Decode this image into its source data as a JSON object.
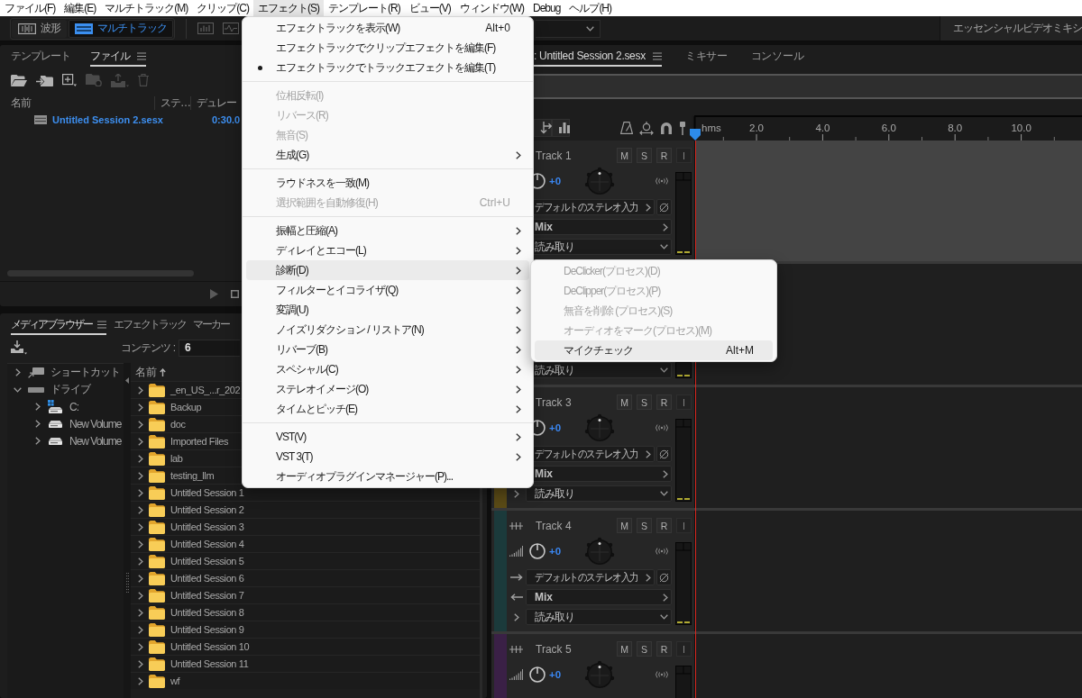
{
  "menu_bar": {
    "items": [
      {
        "label": "ファイル(F)",
        "selected": false
      },
      {
        "label": "編集(E)",
        "selected": false
      },
      {
        "label": "マルチトラック(M)",
        "selected": false
      },
      {
        "label": "クリップ(C)",
        "selected": false
      },
      {
        "label": "エフェクト(S)",
        "selected": true
      },
      {
        "label": "テンプレート(R)",
        "selected": false
      },
      {
        "label": "ビュー(V)",
        "selected": false
      },
      {
        "label": "ウィンドウ(W)",
        "selected": false
      },
      {
        "label": "Debug",
        "selected": false
      },
      {
        "label": "ヘルプ(H)",
        "selected": false
      }
    ]
  },
  "toolbar": {
    "views": [
      {
        "kind": "waveform",
        "label": "波形",
        "selected": false
      },
      {
        "kind": "multitrack",
        "label": "マルチトラック",
        "selected": true
      }
    ],
    "workspace": "エッセンシャルビデオミキシ"
  },
  "files_panel": {
    "tabs": [
      {
        "label": "テンプレート",
        "selected": false
      },
      {
        "label": "ファイル",
        "selected": true
      }
    ],
    "columns": [
      "名前",
      "ステ…",
      "デュレー"
    ],
    "rows": [
      {
        "name": "Untitled Session 2.sesx",
        "duration": "0:30.0"
      }
    ]
  },
  "media_browser": {
    "tabs": [
      {
        "label": "メディアブラウザー",
        "selected": true
      },
      {
        "label": "エフェクトラック",
        "selected": false
      },
      {
        "label": "マーカー",
        "selected": false
      }
    ],
    "contents_label": "コンテンツ :",
    "contents_value": "6",
    "tree": [
      {
        "kind": "shortcut",
        "label": "ショートカット",
        "expanded": false
      },
      {
        "kind": "drives",
        "label": "ドライブ",
        "expanded": true,
        "children": [
          {
            "kind": "system",
            "label": "C:",
            "expanded": false
          },
          {
            "kind": "volume",
            "label": "New Volume",
            "expanded": false
          },
          {
            "kind": "volume",
            "label": "New Volume",
            "expanded": false
          }
        ]
      }
    ],
    "list_column": "名前",
    "files": [
      {
        "name": "_en_US_...r_202",
        "expanded": false
      },
      {
        "name": "Backup",
        "expanded": false
      },
      {
        "name": "doc",
        "expanded": false
      },
      {
        "name": "Imported Files",
        "expanded": false
      },
      {
        "name": "lab",
        "expanded": false
      },
      {
        "name": "testing_llm",
        "expanded": false
      },
      {
        "name": "Untitled Session 1",
        "expanded": false
      },
      {
        "name": "Untitled Session 2",
        "expanded": false
      },
      {
        "name": "Untitled Session 3",
        "expanded": false
      },
      {
        "name": "Untitled Session 4",
        "expanded": false
      },
      {
        "name": "Untitled Session 5",
        "expanded": false
      },
      {
        "name": "Untitled Session 6",
        "expanded": false
      },
      {
        "name": "Untitled Session 7",
        "expanded": false
      },
      {
        "name": "Untitled Session 8",
        "expanded": false
      },
      {
        "name": "Untitled Session 9",
        "expanded": false
      },
      {
        "name": "Untitled Session 10",
        "expanded": false
      },
      {
        "name": "Untitled Session 11",
        "expanded": false
      },
      {
        "name": "wf",
        "expanded": false
      }
    ]
  },
  "editor": {
    "tabs": [
      {
        "label": ": Untitled Session 2.sesx",
        "selected": true
      },
      {
        "label": "ミキサー",
        "selected": false
      },
      {
        "label": "コンソール",
        "selected": false
      }
    ],
    "ruler": [
      "hms",
      "2.0",
      "4.0",
      "6.0",
      "8.0",
      "10.0"
    ],
    "tracks": [
      {
        "kind": "covered",
        "selected": true,
        "name": "Track 1",
        "buttons": [
          {
            "label": "M",
            "disabled": false
          },
          {
            "label": "S",
            "disabled": false
          },
          {
            "label": "R",
            "disabled": false
          },
          {
            "label": "I",
            "disabled": true
          }
        ],
        "volume": "+0",
        "input": "デフォルトのステレオ入力",
        "output": "Mix",
        "automation": "読み取り"
      },
      {
        "kind": "hidden",
        "selected": false,
        "automation": "読み取り"
      },
      {
        "kind": "partial",
        "selected": false,
        "color": "#5a4a16",
        "name": "Track 3",
        "buttons": [
          {
            "label": "M",
            "disabled": false
          },
          {
            "label": "S",
            "disabled": false
          },
          {
            "label": "R",
            "disabled": false
          },
          {
            "label": "I",
            "disabled": true
          }
        ],
        "volume": "+0",
        "input": "デフォルトのステレオ入力",
        "output": "Mix",
        "automation": "読み取り"
      },
      {
        "kind": "full",
        "selected": false,
        "color": "#1b3a3b",
        "name": "Track 4",
        "buttons": [
          {
            "label": "M",
            "disabled": false
          },
          {
            "label": "S",
            "disabled": false
          },
          {
            "label": "R",
            "disabled": false
          },
          {
            "label": "I",
            "disabled": true
          }
        ],
        "volume": "+0",
        "input": "デフォルトのステレオ入力",
        "output": "Mix",
        "automation": "読み取り"
      },
      {
        "kind": "full",
        "selected": false,
        "color": "#3a2046",
        "name": "Track 5",
        "buttons": [
          {
            "label": "M",
            "disabled": false
          },
          {
            "label": "S",
            "disabled": false
          },
          {
            "label": "R",
            "disabled": false
          },
          {
            "label": "I",
            "disabled": true
          }
        ],
        "volume": "+0"
      }
    ]
  },
  "effects_menu": {
    "items": [
      {
        "kind": "item",
        "label": "エフェクトラックを表示(W)",
        "shortcut": "Alt+0",
        "checked": false,
        "disabled": false,
        "submenu": false,
        "selected": false
      },
      {
        "kind": "item",
        "label": "エフェクトラックでクリップエフェクトを編集(F)",
        "checked": false,
        "disabled": false,
        "submenu": false,
        "selected": false
      },
      {
        "kind": "item",
        "label": "エフェクトラックでトラックエフェクトを編集(T)",
        "checked": true,
        "disabled": false,
        "submenu": false,
        "selected": false
      },
      {
        "kind": "separator"
      },
      {
        "kind": "item",
        "label": "位相反転(I)",
        "checked": false,
        "disabled": true,
        "submenu": false,
        "selected": false
      },
      {
        "kind": "item",
        "label": "リバース(R)",
        "checked": false,
        "disabled": true,
        "submenu": false,
        "selected": false
      },
      {
        "kind": "item",
        "label": "無音(S)",
        "checked": false,
        "disabled": true,
        "submenu": false,
        "selected": false
      },
      {
        "kind": "item",
        "label": "生成(G)",
        "checked": false,
        "disabled": false,
        "submenu": true,
        "selected": false
      },
      {
        "kind": "separator"
      },
      {
        "kind": "item",
        "label": "ラウドネスを一致(M)",
        "checked": false,
        "disabled": false,
        "submenu": false,
        "selected": false
      },
      {
        "kind": "item",
        "label": "選択範囲を自動修復(H)",
        "shortcut": "Ctrl+U",
        "checked": false,
        "disabled": true,
        "submenu": false,
        "selected": false
      },
      {
        "kind": "separator"
      },
      {
        "kind": "item",
        "label": "振幅と圧縮(A)",
        "checked": false,
        "disabled": false,
        "submenu": true,
        "selected": false
      },
      {
        "kind": "item",
        "label": "ディレイとエコー(L)",
        "checked": false,
        "disabled": false,
        "submenu": true,
        "selected": false
      },
      {
        "kind": "item",
        "label": "診断(D)",
        "checked": false,
        "disabled": false,
        "submenu": true,
        "selected": true
      },
      {
        "kind": "item",
        "label": "フィルターとイコライザ(Q)",
        "checked": false,
        "disabled": false,
        "submenu": true,
        "selected": false
      },
      {
        "kind": "item",
        "label": "変調(U)",
        "checked": false,
        "disabled": false,
        "submenu": true,
        "selected": false
      },
      {
        "kind": "item",
        "label": "ノイズリダクション / リストア(N)",
        "checked": false,
        "disabled": false,
        "submenu": true,
        "selected": false
      },
      {
        "kind": "item",
        "label": "リバーブ(B)",
        "checked": false,
        "disabled": false,
        "submenu": true,
        "selected": false
      },
      {
        "kind": "item",
        "label": "スペシャル(C)",
        "checked": false,
        "disabled": false,
        "submenu": true,
        "selected": false
      },
      {
        "kind": "item",
        "label": "ステレオイメージ(O)",
        "checked": false,
        "disabled": false,
        "submenu": true,
        "selected": false
      },
      {
        "kind": "item",
        "label": "タイムとピッチ(E)",
        "checked": false,
        "disabled": false,
        "submenu": true,
        "selected": false
      },
      {
        "kind": "separator"
      },
      {
        "kind": "item",
        "label": "VST(V)",
        "checked": false,
        "disabled": false,
        "submenu": true,
        "selected": false
      },
      {
        "kind": "item",
        "label": "VST 3(T)",
        "checked": false,
        "disabled": false,
        "submenu": true,
        "selected": false
      },
      {
        "kind": "item",
        "label": "オーディオプラグインマネージャー(P)...",
        "checked": false,
        "disabled": false,
        "submenu": false,
        "selected": false
      }
    ]
  },
  "diagnostics_submenu": {
    "items": [
      {
        "label": "DeClicker(プロセス)(D)",
        "disabled": true,
        "selected": false
      },
      {
        "label": "DeClipper(プロセス)(P)",
        "disabled": true,
        "selected": false
      },
      {
        "label": "無音を削除 (プロセス)(S)",
        "disabled": true,
        "selected": false
      },
      {
        "label": "オーディオをマーク(プロセス)(M)",
        "disabled": true,
        "selected": false
      },
      {
        "label": "マイクチェック",
        "shortcut": "Alt+M",
        "disabled": false,
        "selected": true
      }
    ]
  }
}
